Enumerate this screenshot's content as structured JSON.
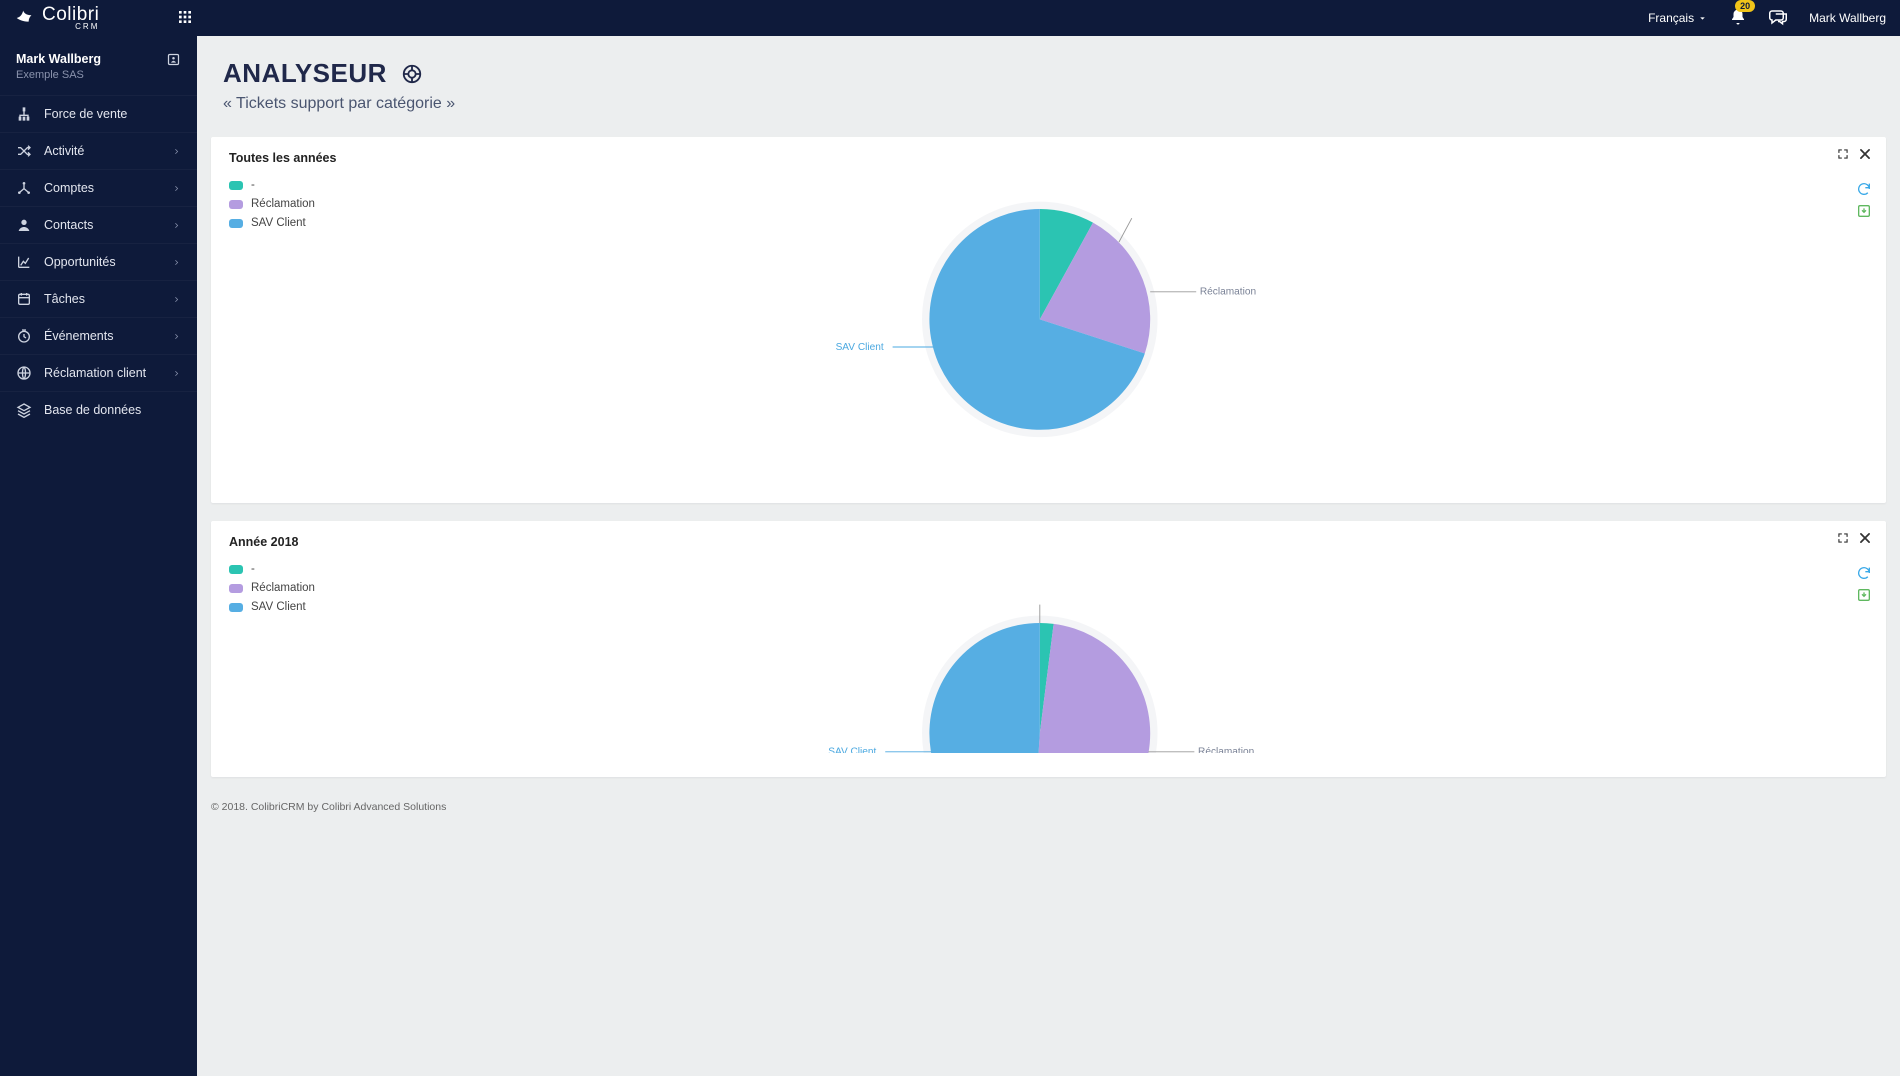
{
  "brand": {
    "name": "Colibri",
    "sub": "CRM"
  },
  "topbar": {
    "language": "Français",
    "notification_count": "20",
    "username": "Mark Wallberg"
  },
  "sidebar": {
    "user": {
      "name": "Mark Wallberg",
      "company": "Exemple SAS"
    },
    "items": [
      {
        "label": "Force de vente",
        "icon": "hierarchy",
        "expand": false
      },
      {
        "label": "Activité",
        "icon": "shuffle",
        "expand": true
      },
      {
        "label": "Comptes",
        "icon": "network",
        "expand": true
      },
      {
        "label": "Contacts",
        "icon": "person",
        "expand": true
      },
      {
        "label": "Opportunités",
        "icon": "chart",
        "expand": true
      },
      {
        "label": "Tâches",
        "icon": "calendar",
        "expand": true
      },
      {
        "label": "Événements",
        "icon": "clock",
        "expand": true
      },
      {
        "label": "Réclamation client",
        "icon": "globe",
        "expand": true
      },
      {
        "label": "Base de données",
        "icon": "layers",
        "expand": false
      }
    ]
  },
  "page": {
    "title": "ANALYSEUR",
    "subtitle": "« Tickets support par catégorie »"
  },
  "panels": [
    {
      "title": "Toutes les années",
      "legend": [
        {
          "label": "-",
          "color": "#2bc4b2"
        },
        {
          "label": "Réclamation",
          "color": "#b49ce0"
        },
        {
          "label": "SAV Client",
          "color": "#56aee3"
        }
      ],
      "pie_labels": {
        "reclamation": "Réclamation",
        "sav": "SAV Client"
      }
    },
    {
      "title": "Année 2018",
      "legend": [
        {
          "label": "-",
          "color": "#2bc4b2"
        },
        {
          "label": "Réclamation",
          "color": "#b49ce0"
        },
        {
          "label": "SAV Client",
          "color": "#56aee3"
        }
      ],
      "pie_labels": {
        "reclamation": "Réclamation",
        "sav": "SAV Client"
      }
    }
  ],
  "footer": "© 2018. ColibriCRM by Colibri Advanced Solutions",
  "colors": {
    "teal": "#2bc4b2",
    "purple": "#b49ce0",
    "blue": "#56aee3"
  },
  "chart_data": [
    {
      "type": "pie",
      "title": "Toutes les années",
      "series": [
        {
          "name": "-",
          "value": 8,
          "color": "#2bc4b2"
        },
        {
          "name": "Réclamation",
          "value": 22,
          "color": "#b49ce0"
        },
        {
          "name": "SAV Client",
          "value": 70,
          "color": "#56aee3"
        }
      ]
    },
    {
      "type": "pie",
      "title": "Année 2018",
      "series": [
        {
          "name": "-",
          "value": 2,
          "color": "#2bc4b2"
        },
        {
          "name": "Réclamation",
          "value": 49,
          "color": "#b49ce0"
        },
        {
          "name": "SAV Client",
          "value": 49,
          "color": "#56aee3"
        }
      ]
    }
  ]
}
